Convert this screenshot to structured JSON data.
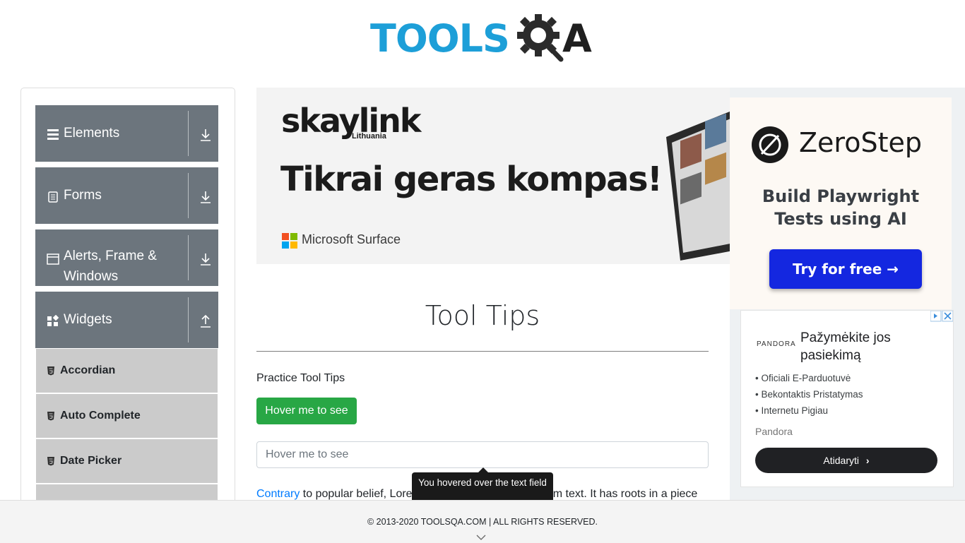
{
  "header": {
    "logo_part1": "TOOLS",
    "logo_part2": "A"
  },
  "sidebar": {
    "groups": [
      {
        "label": "Elements",
        "icon": "menu-icon",
        "toggle": "download-arrow-icon"
      },
      {
        "label": "Forms",
        "icon": "form-icon",
        "toggle": "download-arrow-icon"
      },
      {
        "label": "Alerts, Frame & Windows",
        "label_line1": "Alerts, Frame &",
        "label_line2": "Windows",
        "icon": "window-icon",
        "toggle": "download-arrow-icon"
      },
      {
        "label": "Widgets",
        "icon": "widgets-icon",
        "toggle": "upload-arrow-icon"
      }
    ],
    "widget_items": [
      {
        "label": "Accordian"
      },
      {
        "label": "Auto Complete"
      },
      {
        "label": "Date Picker"
      }
    ]
  },
  "banner_ad": {
    "brand": "skaylink",
    "brand_sub": "Lithuania",
    "headline": "Tikrai geras kompas!",
    "partner": "Microsoft Surface"
  },
  "side_ad": {
    "brand": "ZeroStep",
    "tagline_line1": "Build Playwright",
    "tagline_line2": "Tests using AI",
    "cta": "Try for free →"
  },
  "pandora_ad": {
    "logo": "PANDORA",
    "title": "Pažymėkite jos pasiekimą",
    "bullets": [
      "Oficiali E-Parduotuvė",
      "Bekontaktis Pristatymas",
      "Internetu Pigiau"
    ],
    "source": "Pandora",
    "cta": "Atidaryti"
  },
  "main": {
    "title": "Tool Tips",
    "practice_label": "Practice Tool Tips",
    "hover_button_label": "Hover me to see",
    "hover_input_placeholder": "Hover me to see",
    "paragraph_link": "Contrary",
    "paragraph_text": " to popular belief, Lorem Ipsum is not simply random text. It has roots in a piece",
    "tooltip_text": "You hovered over the text field"
  },
  "footer": {
    "copyright": "© 2013-2020 TOOLSQA.COM | ALL RIGHTS RESERVED."
  },
  "colors": {
    "accent": "#1d9fd8",
    "sidebar_group": "#6c757d",
    "sidebar_item": "#cbcbcb",
    "success": "#28a745",
    "link": "#007bff",
    "zerostep_btn": "#1427e0"
  }
}
